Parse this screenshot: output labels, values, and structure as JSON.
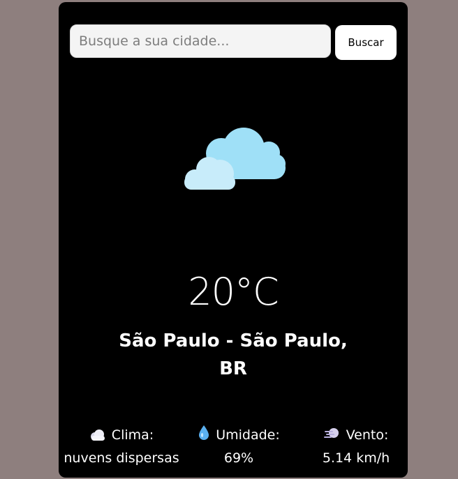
{
  "search": {
    "placeholder": "Busque a sua cidade...",
    "value": "",
    "button_label": "Buscar"
  },
  "weather": {
    "icon": "clouds-icon",
    "temperature": "20°C",
    "city_line1": "São Paulo - São Paulo,",
    "city_line2": "BR"
  },
  "details": {
    "clima": {
      "icon": "cloud-icon",
      "label": "Clima:",
      "value": "nuvens dispersas"
    },
    "umidade": {
      "icon": "droplet-icon",
      "label": "Umidade:",
      "value": "69%"
    },
    "vento": {
      "icon": "wind-icon",
      "label": "Vento:",
      "value": "5.14 km/h"
    }
  },
  "colors": {
    "page_background": "#8e7f7e",
    "card_background": "#000000",
    "text": "#ffffff",
    "cloud_back": "#9fe0f7",
    "cloud_front": "#c8ecfa"
  }
}
